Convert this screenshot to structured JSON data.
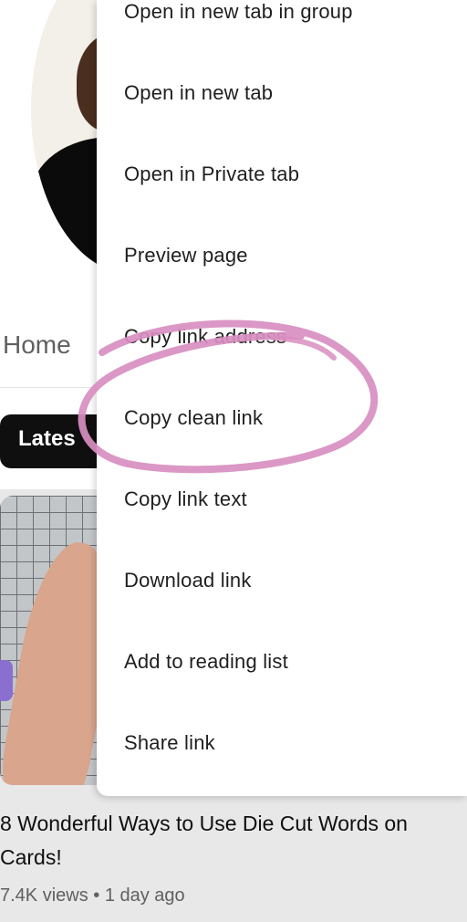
{
  "background": {
    "home_tab": "Home",
    "chip_latest": "Lates",
    "video": {
      "title": "8 Wonderful Ways to Use Die Cut Words on Cards!",
      "meta": "7.4K views • 1 day ago"
    }
  },
  "context_menu": {
    "items": [
      {
        "label": "Open in new tab in group"
      },
      {
        "label": "Open in new tab"
      },
      {
        "label": "Open in Private tab"
      },
      {
        "label": "Preview page"
      },
      {
        "label": "Copy link address"
      },
      {
        "label": "Copy clean link"
      },
      {
        "label": "Copy link text"
      },
      {
        "label": "Download link"
      },
      {
        "label": "Add to reading list"
      },
      {
        "label": "Share link"
      }
    ]
  },
  "annotation": {
    "highlight_color": "#d88ec0"
  }
}
